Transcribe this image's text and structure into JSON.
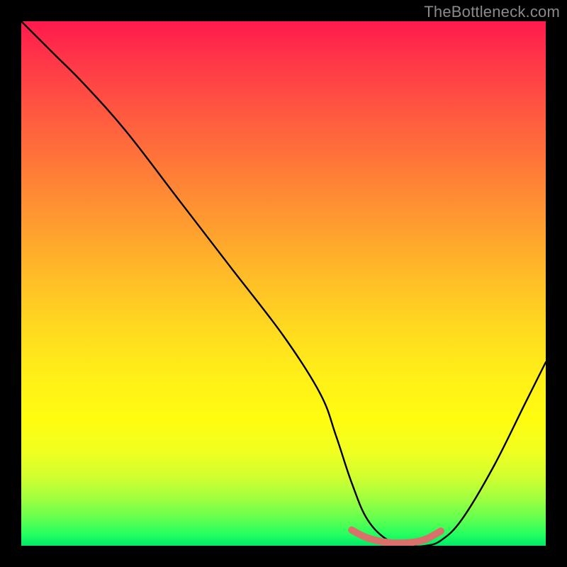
{
  "watermark": "TheBottleneck.com",
  "chart_data": {
    "type": "line",
    "title": "",
    "xlabel": "",
    "ylabel": "",
    "xlim": [
      0,
      100
    ],
    "ylim": [
      0,
      100
    ],
    "legend": false,
    "grid": false,
    "background": "rainbow-vertical",
    "series": [
      {
        "name": "bottleneck-curve",
        "color": "#000000",
        "x": [
          0,
          6,
          12,
          20,
          30,
          40,
          50,
          57,
          60,
          63,
          66,
          70,
          74,
          77,
          80,
          84,
          90,
          96,
          100
        ],
        "values": [
          100,
          94,
          88,
          79,
          66,
          53,
          40,
          29,
          21,
          12,
          5,
          1,
          0,
          0,
          1,
          5,
          15,
          27,
          35
        ]
      },
      {
        "name": "flat-zone-highlight",
        "color": "#d9706a",
        "x": [
          63,
          66,
          70,
          74,
          77,
          80
        ],
        "values": [
          3,
          1.5,
          0.6,
          0.6,
          1.2,
          2.8
        ]
      }
    ],
    "notes": "Values are percentages read from the plotted curve against the gradient backdrop; x is normalized horizontal position, values is normalized height from bottom (0) to top (100)."
  }
}
